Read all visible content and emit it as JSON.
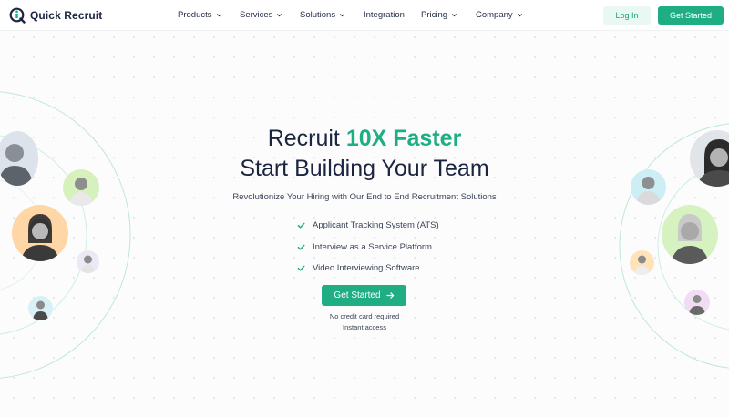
{
  "brand": {
    "name": "Quick Recruit",
    "accent": "#1fae84",
    "dark": "#1b2540"
  },
  "nav": {
    "items": [
      {
        "label": "Products",
        "has_dropdown": true
      },
      {
        "label": "Services",
        "has_dropdown": true
      },
      {
        "label": "Solutions",
        "has_dropdown": true
      },
      {
        "label": "Integration",
        "has_dropdown": false
      },
      {
        "label": "Pricing",
        "has_dropdown": true
      },
      {
        "label": "Company",
        "has_dropdown": true
      }
    ],
    "login_label": "Log In",
    "get_started_label": "Get Started"
  },
  "hero": {
    "title_prefix": "Recruit ",
    "title_accent": "10X Faster",
    "title_line2": "Start Building Your Team",
    "subtitle": "Revolutionize Your Hiring with Our End to End Recruitment Solutions",
    "features": [
      "Applicant Tracking System (ATS)",
      "Interview as a Service Platform",
      "Video Interviewing Software"
    ],
    "cta_label": "Get Started",
    "note_1": "No credit card required",
    "note_2": "Instant access"
  },
  "icons": {
    "logo": "quick-recruit-logo-icon",
    "dropdown": "chevron-down-icon",
    "feature": "check-icon",
    "cta": "arrow-right-icon"
  }
}
